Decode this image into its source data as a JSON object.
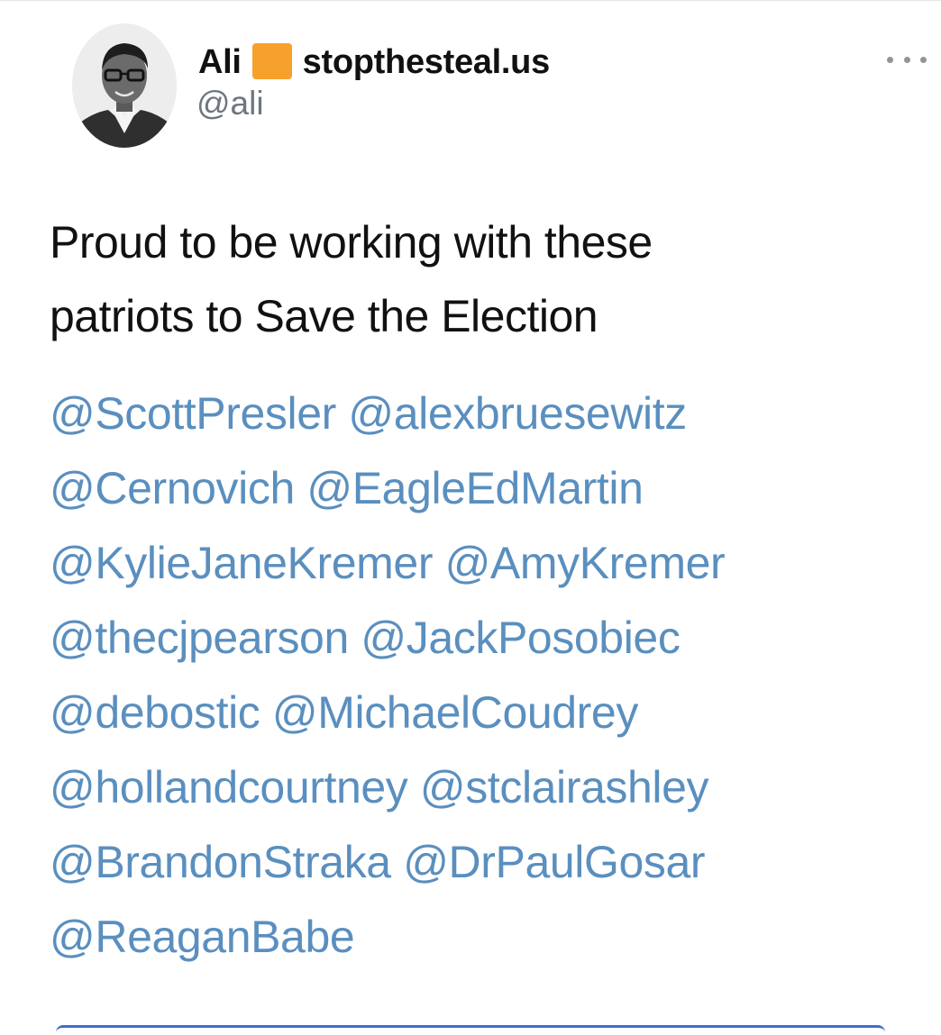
{
  "author": {
    "display_name": "Ali",
    "badge_icon": "orange-square-icon",
    "badge_color": "#f7a12d",
    "site": "stopthesteal.us",
    "handle": "@ali"
  },
  "tweet": {
    "text_line_1": "Proud to be working with these",
    "text_line_2": "patriots to Save the Election",
    "mention_color": "#5a8fbf",
    "mention_lines": [
      [
        "@ScottPresler",
        "@alexbruesewitz"
      ],
      [
        "@Cernovich",
        "@EagleEdMartin"
      ],
      [
        "@KylieJaneKremer",
        "@AmyKremer"
      ],
      [
        "@thecjpearson",
        "@JackPosobiec"
      ],
      [
        "@debostic",
        "@MichaelCoudrey"
      ],
      [
        "@hollandcourtney",
        "@stclairashley"
      ],
      [
        "@BrandonStraka",
        "@DrPaulGosar"
      ],
      [
        "@ReaganBabe"
      ]
    ]
  },
  "more_menu": {
    "icon": "more-horizontal-icon"
  }
}
